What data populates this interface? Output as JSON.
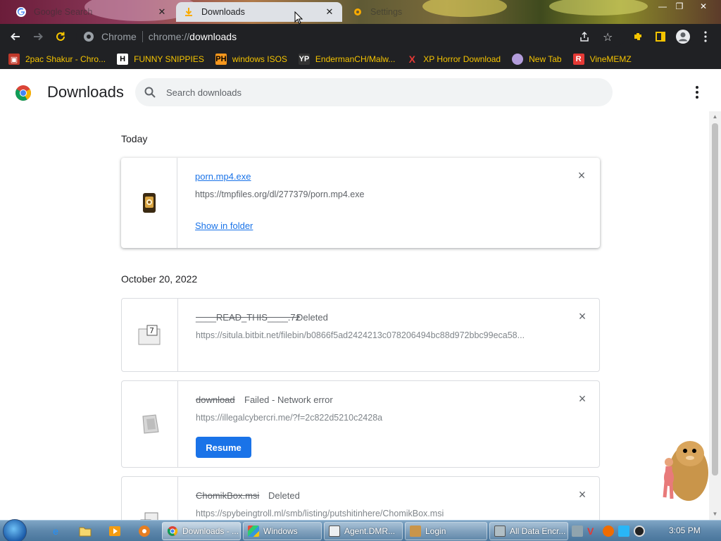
{
  "tabs": [
    {
      "label": "Google Search",
      "state": "inactive",
      "icon": "google-icon"
    },
    {
      "label": "Downloads",
      "state": "active",
      "icon": "downloads-icon"
    },
    {
      "label": "Settings",
      "state": "inactive",
      "icon": "settings-icon"
    }
  ],
  "toolbar": {
    "url_host": "Chrome",
    "url_scheme": "chrome://",
    "url_path": "downloads"
  },
  "bookmarks": [
    {
      "label": "2pac Shakur - Chro...",
      "icon": "2pac-icon"
    },
    {
      "label": "FUNNY SNIPPIES",
      "icon": "h-icon"
    },
    {
      "label": "windows ISOS",
      "icon": "ph-icon"
    },
    {
      "label": "EndermanCH/Malw...",
      "icon": "yp-icon"
    },
    {
      "label": "XP Horror Download",
      "icon": "x-icon"
    },
    {
      "label": "New Tab",
      "icon": "globe-icon"
    },
    {
      "label": "VineMEMZ",
      "icon": "vine-icon"
    }
  ],
  "page": {
    "title": "Downloads",
    "search_placeholder": "Search downloads"
  },
  "groups": [
    {
      "date": "Today",
      "items": [
        {
          "filename": "porn.mp4.exe",
          "status": "",
          "url": "https://tmpfiles.org/dl/277379/porn.mp4.exe",
          "action": "Show in folder"
        }
      ]
    },
    {
      "date": "October 20, 2022",
      "items": [
        {
          "filename": "____READ_THIS____.7z",
          "status": "Deleted",
          "url": "https://situla.bitbit.net/filebin/b0866f5ad2424213c078206494bc88d972bbc99eca58...",
          "action": ""
        },
        {
          "filename": "download",
          "status": "Failed - Network error",
          "url": "https://illegalcybercri.me/?f=2c822d5210c2428a",
          "action": "Resume"
        },
        {
          "filename": "ChomikBox.msi",
          "status": "Deleted",
          "url": "https://spybeingtroll.ml/smb/listing/putshitinhere/ChomikBox.msi",
          "action": ""
        }
      ]
    }
  ],
  "taskbar": {
    "items": [
      {
        "label": "Downloads - ...",
        "active": true,
        "icon": "chrome-icon"
      },
      {
        "label": "Windows",
        "active": false,
        "icon": "windows-icon"
      },
      {
        "label": "Agent.DMR...",
        "active": false,
        "icon": "app-icon"
      },
      {
        "label": "Login",
        "active": false,
        "icon": "login-icon"
      },
      {
        "label": "All Data Encr...",
        "active": false,
        "icon": "lock-icon"
      }
    ],
    "clock": "3:05 PM"
  },
  "colors": {
    "accent": "#1a73e8",
    "bookmark_text": "#f5c400",
    "toolbar_bg": "#202124"
  }
}
